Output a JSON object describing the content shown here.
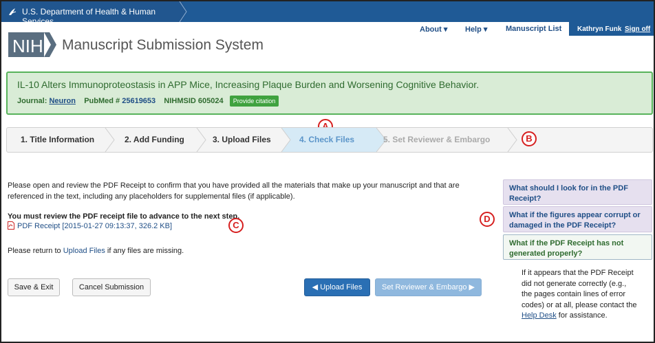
{
  "hhs": {
    "name": "U.S. Department of Health & Human Services"
  },
  "header": {
    "logo_text": "NIH",
    "title": "Manuscript Submission System",
    "nav": [
      {
        "label": "About ▾"
      },
      {
        "label": "Help ▾"
      },
      {
        "label": "Manuscript List"
      }
    ],
    "user": "Kathryn Funk",
    "signoff": "Sign off"
  },
  "manuscript": {
    "title": "IL-10 Alters Immunoproteostasis in APP Mice, Increasing Plaque Burden and Worsening Cognitive Behavior.",
    "journal_label": "Journal:",
    "journal": "Neuron",
    "pubmed_label": "PubMed #",
    "pubmed": "25619653",
    "nihmsid": "NIHMSID 605024",
    "cite_button": "Provide citation"
  },
  "steps": [
    {
      "label": "1. Title Information",
      "state": "done"
    },
    {
      "label": "2. Add Funding",
      "state": "done"
    },
    {
      "label": "3. Upload Files",
      "state": "done"
    },
    {
      "label": "4. Check Files",
      "state": "active"
    },
    {
      "label": "5. Set Reviewer & Embargo",
      "state": "disabled"
    }
  ],
  "markers": {
    "a": "A",
    "b": "B",
    "c": "C",
    "d": "D"
  },
  "content": {
    "intro": "Please open and review the PDF Receipt to confirm that you have provided all the materials that make up your manuscript and that are referenced in the text, including any placeholders for supplemental files (if applicable).",
    "must_review": "You must review the PDF receipt file to advance to the next step.",
    "receipt_link": "PDF Receipt [2015-01-27 09:13:37, 326.2 KB]",
    "return_prefix": "Please return to ",
    "return_link": "Upload Files",
    "return_suffix": " if any files are missing."
  },
  "buttons": {
    "save_exit": "Save & Exit",
    "cancel": "Cancel Submission",
    "upload": "◀ Upload Files",
    "reviewer": "Set Reviewer & Embargo ▶"
  },
  "help": {
    "q1": "What should I look for in the PDF Receipt?",
    "q2": "What if the figures appear corrupt or damaged in the PDF Receipt?",
    "q3": "What if the PDF Receipt has not generated properly?",
    "answer_text": "If it appears that the PDF Receipt did not generate correctly (e.g., the pages contain lines of error codes) or at all, please contact the ",
    "answer_link": "Help Desk",
    "answer_suffix": " for assistance."
  },
  "colors": {
    "hhs_bar": "#1f5a96",
    "success_green": "#57b35a",
    "active_step": "#5b95c9",
    "marker_red": "#d61f1f"
  }
}
